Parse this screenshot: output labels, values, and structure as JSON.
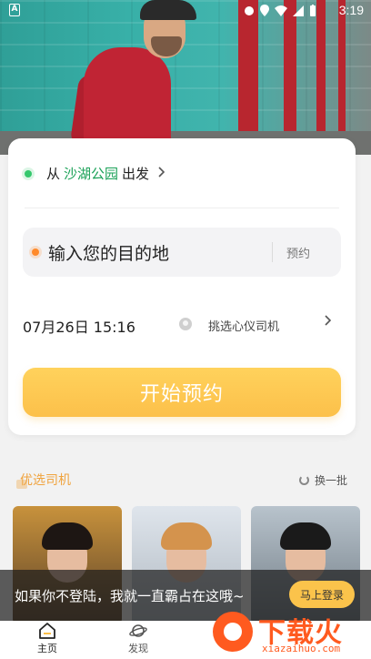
{
  "status_bar": {
    "time": "3:19",
    "app_badge": "A",
    "icons": [
      "notification-icon",
      "location-icon",
      "wifi-icon",
      "signal-icon",
      "battery-icon"
    ]
  },
  "booking": {
    "from_prefix": "从",
    "from_place": "沙湖公园",
    "from_suffix": "出发",
    "destination_placeholder": "输入您的目的地",
    "reserve_label": "预约",
    "datetime": "07月26日 15:16",
    "driver_choice_label": "挑选心仪司机",
    "start_button": "开始预约"
  },
  "drivers_section": {
    "title": "优选司机",
    "refresh_label": "换一批",
    "cards": [
      {
        "id": "driver-1"
      },
      {
        "id": "driver-2"
      },
      {
        "id": "driver-3"
      }
    ]
  },
  "login_banner": {
    "message": "如果你不登陆，我就一直霸占在这哦~",
    "button": "马上登录"
  },
  "bottom_nav": {
    "items": [
      {
        "label": "主页",
        "icon": "home-icon",
        "active": true
      },
      {
        "label": "发现",
        "icon": "planet-icon",
        "active": false
      }
    ]
  },
  "watermark": {
    "brand": "下载火",
    "domain": "xiazaihuo.com"
  },
  "colors": {
    "accent_yellow": "#fcc04a",
    "green_place": "#1aa157",
    "orange_dot": "#ff8a2b",
    "section_title": "#f0a33d"
  }
}
